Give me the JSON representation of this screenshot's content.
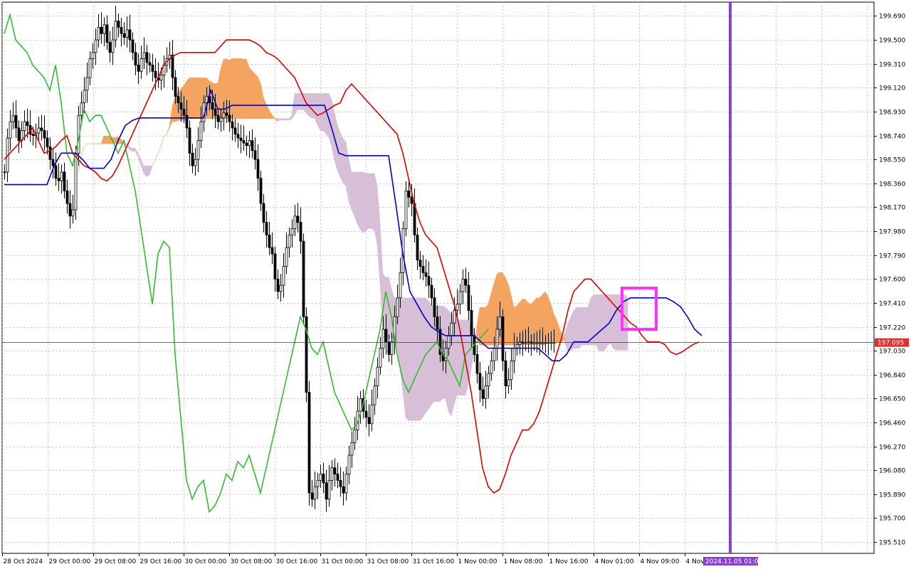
{
  "chart_data": {
    "type": "candlestick",
    "indicator": "ichimoku",
    "y_ticks": [
      199.69,
      199.5,
      199.31,
      199.12,
      198.93,
      198.74,
      198.55,
      198.36,
      198.17,
      197.98,
      197.79,
      197.6,
      197.41,
      197.22,
      197.03,
      196.84,
      196.65,
      196.46,
      196.27,
      196.08,
      195.89,
      195.7,
      195.51
    ],
    "y_tick_labels": [
      "199.690",
      "199.500",
      "199.310",
      "199.120",
      "198.930",
      "198.740",
      "198.550",
      "198.360",
      "198.170",
      "197.980",
      "197.790",
      "197.600",
      "197.410",
      "197.220",
      "197.030",
      "196.840",
      "196.650",
      "196.460",
      "196.270",
      "196.080",
      "195.890",
      "195.700",
      "195.510"
    ],
    "x_labels": [
      "28 Oct 2024",
      "29 Oct 00:00",
      "29 Oct 08:00",
      "29 Oct 16:00",
      "30 Oct 00:00",
      "30 Oct 08:00",
      "30 Oct 16:00",
      "31 Oct 00:00",
      "31 Oct 08:00",
      "31 Oct 16:00",
      "1 Nov 00:00",
      "1 Nov 08:00",
      "1 Nov 16:00",
      "4 Nov 01:00",
      "4 Nov 09:00",
      "4 Nov"
    ],
    "current_price": 197.095,
    "current_price_label": "197.095",
    "cursor_time_label": "2024.11.05 01:00",
    "ylim": [
      195.42,
      199.8
    ],
    "bar_count": 192,
    "closes": [
      198.45,
      198.72,
      198.85,
      198.9,
      198.8,
      198.7,
      198.78,
      198.85,
      198.82,
      198.75,
      198.74,
      198.76,
      198.8,
      198.78,
      198.72,
      198.65,
      198.55,
      198.5,
      198.4,
      198.38,
      198.45,
      198.3,
      198.2,
      198.1,
      198.15,
      198.6,
      198.9,
      199.0,
      199.1,
      199.2,
      199.35,
      199.4,
      199.5,
      199.6,
      199.55,
      199.62,
      199.48,
      199.4,
      199.5,
      199.65,
      199.6,
      199.55,
      199.52,
      199.58,
      199.5,
      199.4,
      199.3,
      199.25,
      199.35,
      199.4,
      199.32,
      199.3,
      199.25,
      199.2,
      199.18,
      199.22,
      199.3,
      199.35,
      199.38,
      199.2,
      199.05,
      199.0,
      198.95,
      198.9,
      198.8,
      198.6,
      198.5,
      198.55,
      198.7,
      198.85,
      199.0,
      199.05,
      199.0,
      198.95,
      198.9,
      198.85,
      198.88,
      198.92,
      198.9,
      198.85,
      198.8,
      198.75,
      198.72,
      198.7,
      198.68,
      198.66,
      198.7,
      198.62,
      198.55,
      198.4,
      198.2,
      198.05,
      197.95,
      197.85,
      197.8,
      197.6,
      197.5,
      197.55,
      197.7,
      197.85,
      197.95,
      198.0,
      198.1,
      198.05,
      197.9,
      197.3,
      196.7,
      195.9,
      195.85,
      195.95,
      196.0,
      196.05,
      195.98,
      195.85,
      196.0,
      196.1,
      196.05,
      196.0,
      195.95,
      195.9,
      196.05,
      196.2,
      196.3,
      196.4,
      196.55,
      196.65,
      196.55,
      196.5,
      196.45,
      196.6,
      196.75,
      196.9,
      197.05,
      197.2,
      197.1,
      197.0,
      197.1,
      197.3,
      197.45,
      197.65,
      198.0,
      198.3,
      198.25,
      198.2,
      197.95,
      197.75,
      197.7,
      197.65,
      197.62,
      197.55,
      197.45,
      197.3,
      197.2,
      197.0,
      196.95,
      197.05,
      197.15,
      197.25,
      197.35,
      197.4,
      197.5,
      197.6,
      197.55,
      197.35,
      197.15,
      197.0,
      196.85,
      196.72,
      196.65,
      196.75,
      196.85,
      196.95,
      197.05,
      197.2,
      197.3,
      196.95,
      196.75,
      196.8,
      196.95,
      197.05,
      197.08,
      197.1,
      197.09,
      197.095,
      197.1,
      197.09,
      197.095,
      197.095,
      197.095,
      197.095,
      197.095,
      197.095,
      197.095,
      197.095
    ],
    "tenkan": [
      198.55,
      198.6,
      198.65,
      198.7,
      198.75,
      198.8,
      198.7,
      198.6,
      198.62,
      198.65,
      198.7,
      198.74,
      198.6,
      198.55,
      198.5,
      198.48,
      198.45,
      198.4,
      198.38,
      198.42,
      198.5,
      198.6,
      198.7,
      198.8,
      198.9,
      199.0,
      199.1,
      199.2,
      199.3,
      199.35,
      199.38,
      199.4,
      199.4,
      199.4,
      199.4,
      199.4,
      199.4,
      199.4,
      199.45,
      199.5,
      199.5,
      199.5,
      199.5,
      199.5,
      199.48,
      199.45,
      199.4,
      199.38,
      199.35,
      199.3,
      199.25,
      199.2,
      199.1,
      199.0,
      198.95,
      198.9,
      198.92,
      198.95,
      198.98,
      199.0,
      199.1,
      199.15,
      199.1,
      199.05,
      199.0,
      198.95,
      198.9,
      198.85,
      198.8,
      198.75,
      198.6,
      198.4,
      198.2,
      198.05,
      197.95,
      197.9,
      197.85,
      197.7,
      197.55,
      197.4,
      197.2,
      196.95,
      196.7,
      196.4,
      196.1,
      195.95,
      195.9,
      195.93,
      196.05,
      196.2,
      196.3,
      196.4,
      196.4,
      196.45,
      196.55,
      196.7,
      196.85,
      197.0,
      197.15,
      197.35,
      197.5,
      197.55,
      197.6,
      197.6,
      197.55,
      197.5,
      197.45,
      197.4,
      197.35,
      197.3,
      197.25,
      197.22,
      197.15,
      197.1,
      197.1,
      197.1,
      197.08,
      197.02,
      197.0,
      197.02,
      197.05,
      197.08,
      197.1
    ],
    "kijun": [
      198.35,
      198.35,
      198.35,
      198.35,
      198.35,
      198.35,
      198.35,
      198.5,
      198.6,
      198.6,
      198.6,
      198.55,
      198.48,
      198.48,
      198.48,
      198.55,
      198.7,
      198.82,
      198.86,
      198.88,
      198.88,
      198.88,
      198.88,
      198.88,
      198.88,
      198.88,
      198.88,
      198.88,
      198.88,
      199.1,
      198.95,
      198.95,
      198.98,
      198.98,
      198.98,
      198.98,
      198.98,
      198.98,
      198.98,
      198.98,
      198.98,
      198.98,
      198.98,
      198.98,
      198.98,
      198.98,
      198.8,
      198.6,
      198.58,
      198.58,
      198.58,
      198.58,
      198.58,
      198.58,
      198.58,
      198.2,
      197.8,
      197.5,
      197.4,
      197.3,
      197.22,
      197.18,
      197.15,
      197.15,
      197.15,
      197.15,
      197.15,
      197.1,
      197.05,
      197.05,
      197.05,
      197.05,
      197.05,
      197.05,
      197.05,
      197.05,
      197.0,
      196.95,
      196.95,
      197.0,
      197.1,
      197.1,
      197.1,
      197.15,
      197.2,
      197.25,
      197.35,
      197.42,
      197.45,
      197.45,
      197.45,
      197.45,
      197.45,
      197.45,
      197.42,
      197.38,
      197.3,
      197.2,
      197.15
    ],
    "chikou": [
      199.55,
      199.7,
      199.5,
      199.45,
      199.4,
      199.3,
      199.25,
      199.2,
      199.1,
      199.3,
      199.0,
      198.6,
      198.5,
      198.7,
      198.95,
      198.85,
      198.9,
      198.9,
      198.8,
      198.7,
      198.6,
      198.7,
      198.5,
      198.3,
      198.0,
      197.7,
      197.4,
      197.8,
      197.9,
      197.85,
      197.0,
      196.5,
      196.0,
      195.85,
      195.95,
      196.0,
      195.75,
      195.8,
      195.9,
      196.05,
      196.0,
      196.15,
      196.1,
      196.2,
      196.05,
      195.9,
      196.1,
      196.3,
      196.5,
      196.7,
      196.9,
      197.1,
      197.3,
      197.2,
      197.05,
      197.0,
      197.1,
      196.9,
      196.7,
      196.6,
      196.5,
      196.4,
      196.45,
      196.6,
      196.8,
      197.0,
      197.2,
      197.5,
      197.3,
      197.0,
      196.8,
      196.7,
      196.8,
      196.9,
      197.0,
      197.05,
      197.1,
      197.0,
      196.95,
      196.85,
      196.75,
      197.0,
      197.05,
      197.1,
      197.15,
      197.2
    ]
  }
}
